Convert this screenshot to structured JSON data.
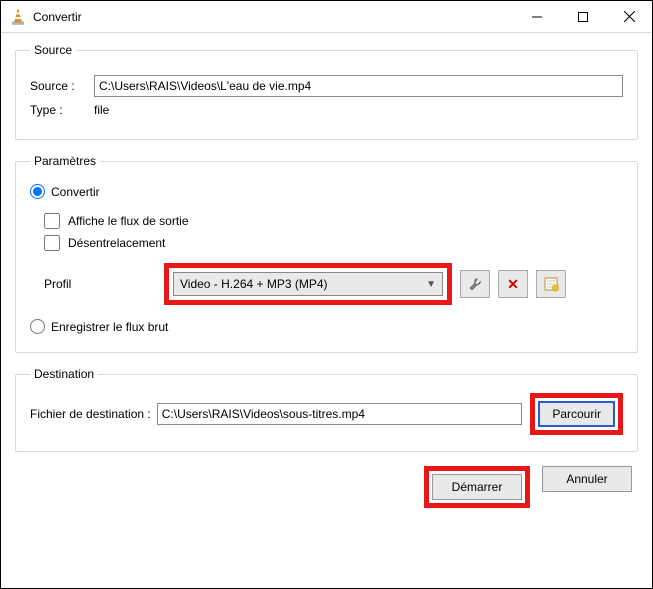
{
  "window": {
    "title": "Convertir"
  },
  "source": {
    "legend": "Source",
    "source_label": "Source :",
    "source_value": "C:\\Users\\RAIS\\Videos\\L'eau de vie.mp4",
    "type_label": "Type :",
    "type_value": "file"
  },
  "settings": {
    "legend": "Paramètres",
    "convert_label": "Convertir",
    "show_output_label": "Affiche le flux de sortie",
    "deinterlace_label": "Désentrelacement",
    "profile_label": "Profil",
    "profile_value": "Video - H.264 + MP3 (MP4)",
    "raw_label": "Enregistrer le flux brut"
  },
  "destination": {
    "legend": "Destination",
    "file_label": "Fichier de destination :",
    "file_value": "C:\\Users\\RAIS\\Videos\\sous-titres.mp4",
    "browse_label": "Parcourir"
  },
  "footer": {
    "start_label": "Démarrer",
    "cancel_label": "Annuler"
  }
}
